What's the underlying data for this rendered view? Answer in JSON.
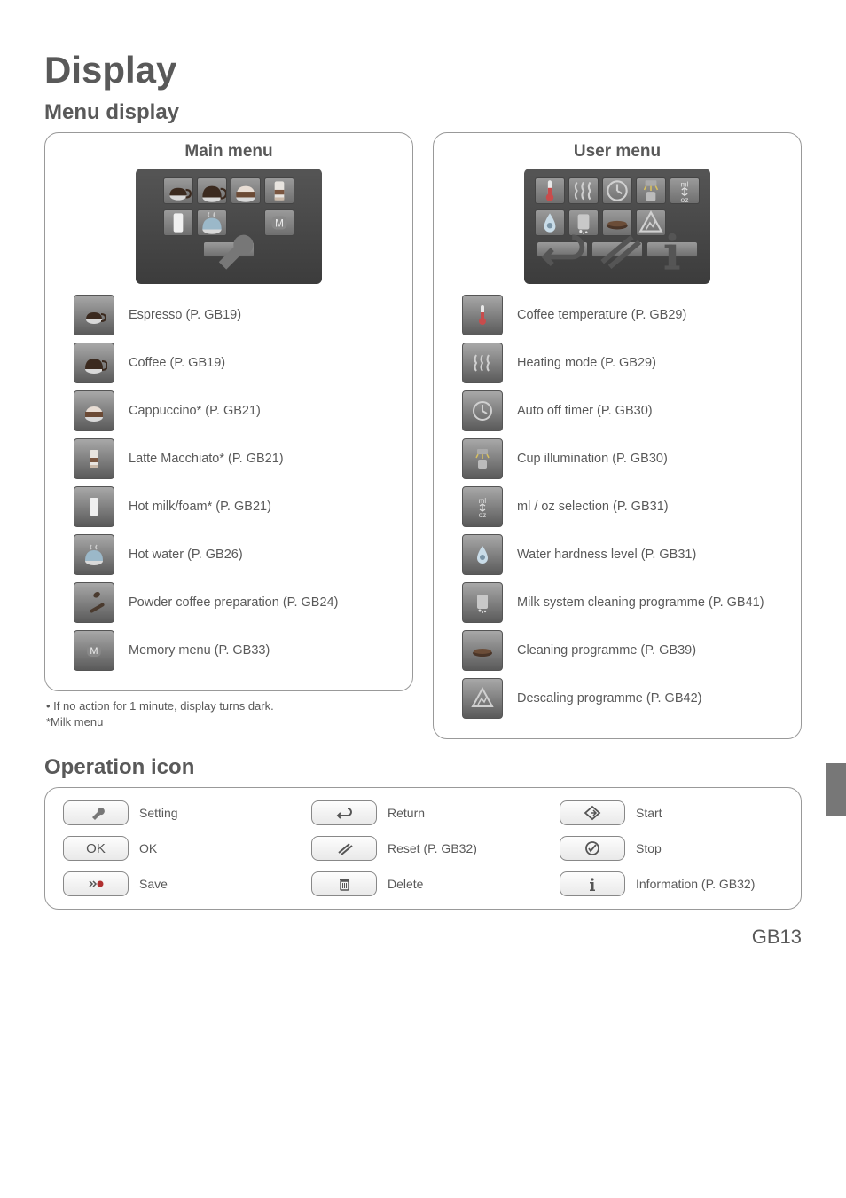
{
  "title": "Display",
  "section_menu": "Menu display",
  "panels": {
    "main": {
      "title": "Main menu",
      "items": [
        {
          "label": "Espresso (P. GB19)",
          "icon": "espresso"
        },
        {
          "label": "Coffee (P. GB19)",
          "icon": "coffee"
        },
        {
          "label": "Cappuccino* (P. GB21)",
          "icon": "cappuccino"
        },
        {
          "label": "Latte Macchiato* (P. GB21)",
          "icon": "latte"
        },
        {
          "label": "Hot milk/foam* (P. GB21)",
          "icon": "milk"
        },
        {
          "label": "Hot water (P. GB26)",
          "icon": "hotwater"
        },
        {
          "label": "Powder coffee preparation (P. GB24)",
          "icon": "powder"
        },
        {
          "label": "Memory menu (P. GB33)",
          "icon": "memory"
        }
      ],
      "notes": [
        "• If no action for 1 minute, display turns dark.",
        "*Milk menu"
      ]
    },
    "user": {
      "title": "User menu",
      "items": [
        {
          "label": "Coffee temperature (P. GB29)",
          "icon": "thermo"
        },
        {
          "label": "Heating mode (P. GB29)",
          "icon": "heat"
        },
        {
          "label": "Auto off timer (P. GB30)",
          "icon": "clock"
        },
        {
          "label": "Cup illumination (P. GB30)",
          "icon": "illum"
        },
        {
          "label": "ml / oz selection (P. GB31)",
          "icon": "mloz"
        },
        {
          "label": "Water hardness level (P. GB31)",
          "icon": "hardness"
        },
        {
          "label": "Milk system cleaning programme (P. GB41)",
          "icon": "milkclean"
        },
        {
          "label": "Cleaning programme (P. GB39)",
          "icon": "clean"
        },
        {
          "label": "Descaling programme (P. GB42)",
          "icon": "descale"
        }
      ]
    }
  },
  "section_op": "Operation icon",
  "ops": [
    {
      "label": "Setting",
      "icon": "wrench"
    },
    {
      "label": "Return",
      "icon": "return"
    },
    {
      "label": "Start",
      "icon": "start"
    },
    {
      "label": "OK",
      "icon": "ok"
    },
    {
      "label": "Reset (P. GB32)",
      "icon": "reset"
    },
    {
      "label": "Stop",
      "icon": "stop"
    },
    {
      "label": "Save",
      "icon": "save"
    },
    {
      "label": "Delete",
      "icon": "delete"
    },
    {
      "label": "Information (P. GB32)",
      "icon": "info"
    }
  ],
  "page_number": "GB13"
}
